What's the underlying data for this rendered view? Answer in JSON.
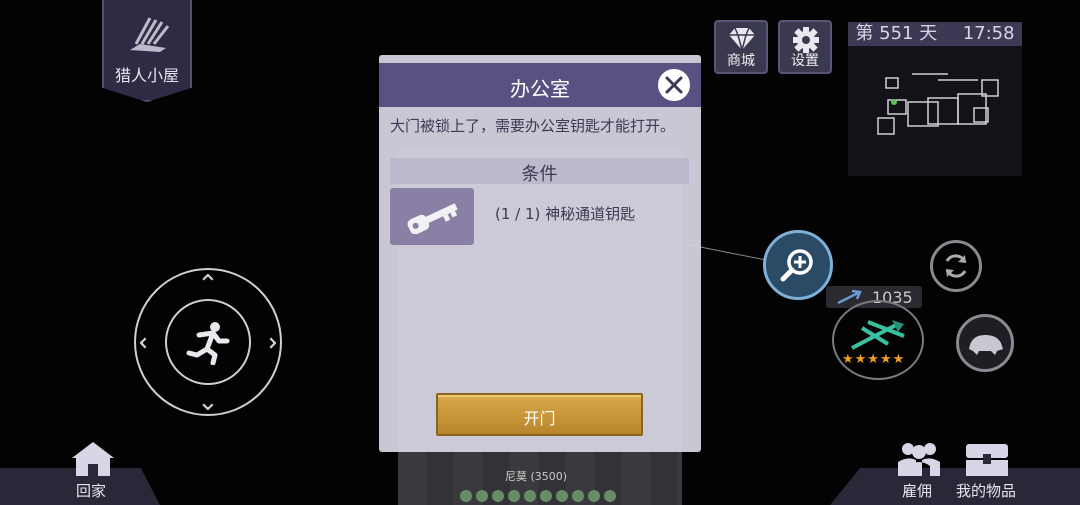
{
  "top_left": {
    "hunter_cabin_label": "猎人小屋"
  },
  "top_right": {
    "shop_label": "商城",
    "settings_label": "设置",
    "day_text": "第 551 天",
    "time_text": "17:58"
  },
  "weapon": {
    "ammo_count": "1035",
    "stars": "★★★★★"
  },
  "bottom": {
    "home_label": "回家",
    "hire_label": "雇佣",
    "inventory_label": "我的物品"
  },
  "scene": {
    "npc_label": "尼莫 (3500)"
  },
  "dialog": {
    "title": "办公室",
    "message": "大门被锁上了，需要办公室钥匙才能打开。",
    "conditions_title": "条件",
    "requirement_text": "(1 / 1) 神秘通道钥匙",
    "open_button_label": "开门"
  },
  "colors": {
    "dialog_header": "#5a5082",
    "button_gold": "#c89a3c",
    "bg": "#030304"
  }
}
